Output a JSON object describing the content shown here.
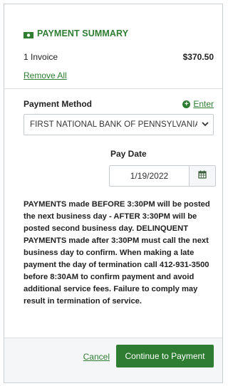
{
  "summary": {
    "title": "PAYMENT SUMMARY",
    "invoice_label": "1 Invoice",
    "invoice_amount": "$370.50",
    "remove_all": "Remove All"
  },
  "payment_method": {
    "label": "Payment Method",
    "enter_link": "Enter",
    "selected": "FIRST NATIONAL BANK OF PENNSYLVANIA"
  },
  "pay_date": {
    "label": "Pay Date",
    "value": "1/19/2022"
  },
  "notice": "PAYMENTS made BEFORE 3:30PM will be posted the next business day - AFTER 3:30PM will be posted second business day. DELINQUENT PAYMENTS made after 3:30PM must call the next business day to confirm. When making a late payment the day of termination call 412-931-3500 before 8:30AM to confirm payment and avoid additional service fees. Failure to comply may result in termination of service.",
  "footer": {
    "cancel": "Cancel",
    "continue": "Continue to Payment"
  },
  "colors": {
    "accent": "#2e7d32"
  },
  "icons": {
    "title": "money-icon",
    "enter": "plus-circle-icon",
    "date": "calendar-icon",
    "select": "chevron-down-icon"
  }
}
